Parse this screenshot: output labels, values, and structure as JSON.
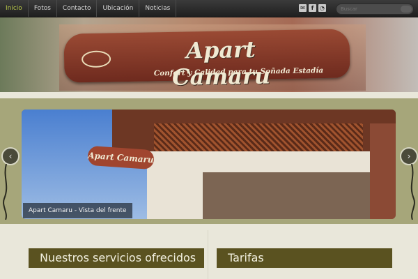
{
  "nav": {
    "items": [
      "Inicio",
      "Fotos",
      "Contacto",
      "Ubicación",
      "Noticias"
    ]
  },
  "search": {
    "placeholder": "Buscar"
  },
  "banner": {
    "title": "Apart Camaru",
    "subtitle": "Confort y Calidad para tu Soñada Estadía"
  },
  "slider": {
    "caption": "Apart Camaru - Vista del frente",
    "photo_sign": "Apart Camaru"
  },
  "sections": {
    "services_title": "Nuestros servicios ofrecidos",
    "rates_title": "Tarifas"
  },
  "colors": {
    "nav_bg": "#2a2a2a",
    "accent_olive": "#a6a67a",
    "section_header": "#5a5220",
    "page_bg": "#e9e7da"
  },
  "icons": [
    "mail-icon",
    "facebook-icon",
    "rss-icon",
    "search-icon",
    "arrow-left-icon",
    "arrow-right-icon"
  ]
}
